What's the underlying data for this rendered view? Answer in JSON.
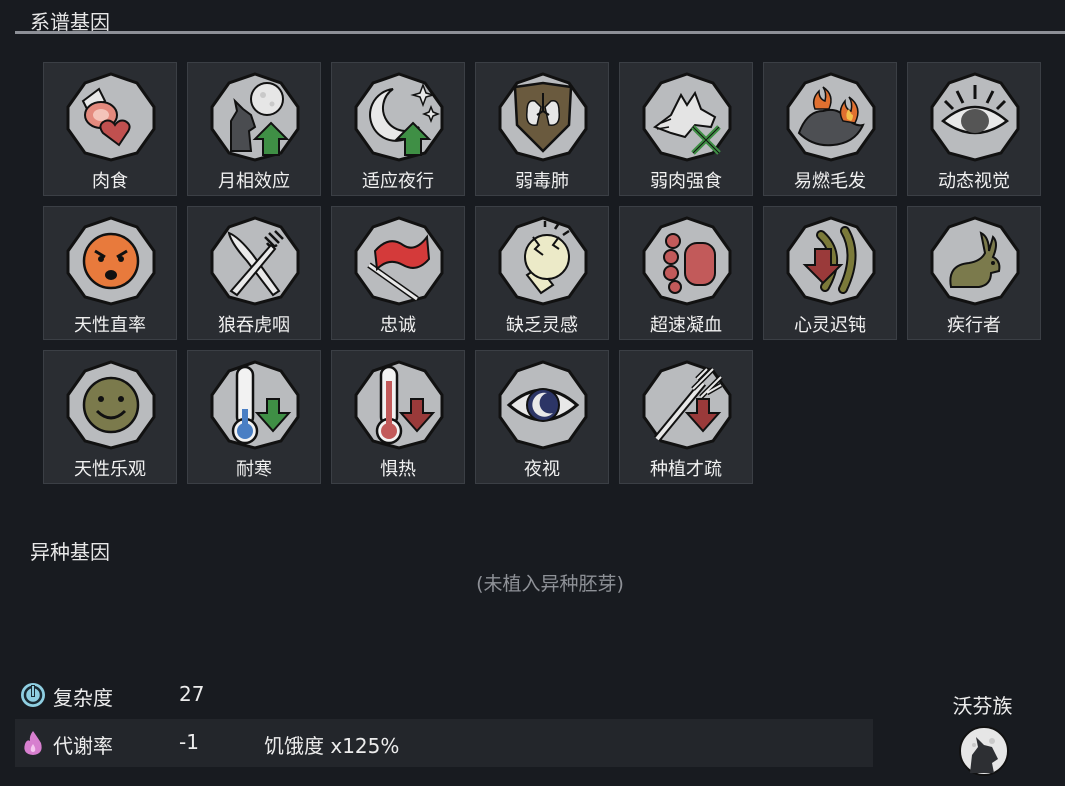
{
  "xenogenes": {
    "title": "系谱基因",
    "genes": [
      {
        "label": "肉食",
        "icon": "meat-heart-icon"
      },
      {
        "label": "月相效应",
        "icon": "wolf-moon-icon"
      },
      {
        "label": "适应夜行",
        "icon": "moon-stars-icon"
      },
      {
        "label": "弱毒肺",
        "icon": "lung-shield-icon"
      },
      {
        "label": "弱肉强食",
        "icon": "wolf-swords-icon"
      },
      {
        "label": "易燃毛发",
        "icon": "burning-fur-icon"
      },
      {
        "label": "动态视觉",
        "icon": "alert-eye-icon"
      },
      {
        "label": "天性直率",
        "icon": "angry-face-icon"
      },
      {
        "label": "狼吞虎咽",
        "icon": "knife-fork-icon"
      },
      {
        "label": "忠诚",
        "icon": "flag-icon"
      },
      {
        "label": "缺乏灵感",
        "icon": "broken-bulb-icon"
      },
      {
        "label": "超速凝血",
        "icon": "blood-clot-icon"
      },
      {
        "label": "心灵迟钝",
        "icon": "psychic-dull-icon"
      },
      {
        "label": "疾行者",
        "icon": "rabbit-icon"
      },
      {
        "label": "天性乐观",
        "icon": "smile-face-icon"
      },
      {
        "label": "耐寒",
        "icon": "cold-thermometer-icon"
      },
      {
        "label": "惧热",
        "icon": "heat-thermometer-icon"
      },
      {
        "label": "夜视",
        "icon": "night-eye-icon"
      },
      {
        "label": "种植才疏",
        "icon": "rake-down-icon"
      }
    ]
  },
  "archite": {
    "title": "异种基因",
    "empty_text": "(未植入异种胚芽)"
  },
  "stats": {
    "complexity": {
      "label": "复杂度",
      "value": "27",
      "icon": "complexity-icon"
    },
    "metabolism": {
      "label": "代谢率",
      "value": "-1",
      "extra": "饥饿度 x125%",
      "icon": "metabolism-icon"
    }
  },
  "xenotype": {
    "name": "沃芬族",
    "icon": "wolf-moon-icon"
  },
  "colors": {
    "background": "#181b20",
    "card": "#2a2d32",
    "badge_fill": "#b9bbbe",
    "green_arrow": "#3f8f45",
    "red_arrow": "#9a3a3a"
  }
}
